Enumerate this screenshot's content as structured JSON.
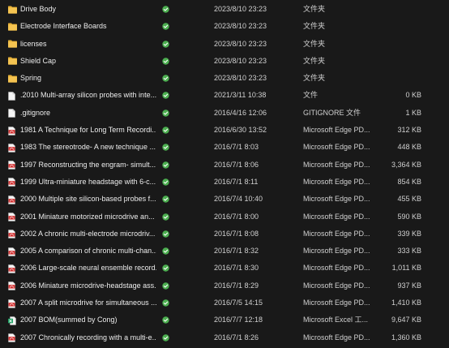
{
  "colors": {
    "background": "#191919",
    "folder": "#e8b339",
    "pdf": "#d32f2f",
    "excel": "#21a366",
    "sync_ok": "#4caf50"
  },
  "files": [
    {
      "icon": "folder-icon",
      "name": "Drive Body",
      "modified": "2023/8/10 23:23",
      "type": "文件夹",
      "size": ""
    },
    {
      "icon": "folder-icon",
      "name": "Electrode Interface Boards",
      "modified": "2023/8/10 23:23",
      "type": "文件夹",
      "size": ""
    },
    {
      "icon": "folder-icon",
      "name": "licenses",
      "modified": "2023/8/10 23:23",
      "type": "文件夹",
      "size": ""
    },
    {
      "icon": "folder-icon",
      "name": "Shield Cap",
      "modified": "2023/8/10 23:23",
      "type": "文件夹",
      "size": ""
    },
    {
      "icon": "folder-icon",
      "name": "Spring",
      "modified": "2023/8/10 23:23",
      "type": "文件夹",
      "size": ""
    },
    {
      "icon": "text-file-icon",
      "name": ".2010 Multi-array silicon probes with inte...",
      "modified": "2021/3/11 10:38",
      "type": "文件",
      "size": "0 KB"
    },
    {
      "icon": "text-file-icon",
      "name": ".gitignore",
      "modified": "2016/4/16 12:06",
      "type": "GITIGNORE 文件",
      "size": "1 KB"
    },
    {
      "icon": "pdf-file-icon",
      "name": "1981 A Technique for Long Term Recordi...",
      "modified": "2016/6/30 13:52",
      "type": "Microsoft Edge PD...",
      "size": "312 KB"
    },
    {
      "icon": "pdf-file-icon",
      "name": "1983 The stereotrode- A new technique ...",
      "modified": "2016/7/1 8:03",
      "type": "Microsoft Edge PD...",
      "size": "448 KB"
    },
    {
      "icon": "pdf-file-icon",
      "name": "1997 Reconstructing the engram- simult...",
      "modified": "2016/7/1 8:06",
      "type": "Microsoft Edge PD...",
      "size": "3,364 KB"
    },
    {
      "icon": "pdf-file-icon",
      "name": "1999 Ultra-miniature headstage with 6-c...",
      "modified": "2016/7/1 8:11",
      "type": "Microsoft Edge PD...",
      "size": "854 KB"
    },
    {
      "icon": "pdf-file-icon",
      "name": "2000 Multiple site silicon-based probes f...",
      "modified": "2016/7/4 10:40",
      "type": "Microsoft Edge PD...",
      "size": "455 KB"
    },
    {
      "icon": "pdf-file-icon",
      "name": "2001 Miniature motorized microdrive an...",
      "modified": "2016/7/1 8:00",
      "type": "Microsoft Edge PD...",
      "size": "590 KB"
    },
    {
      "icon": "pdf-file-icon",
      "name": "2002 A chronic multi-electrode microdriv...",
      "modified": "2016/7/1 8:08",
      "type": "Microsoft Edge PD...",
      "size": "339 KB"
    },
    {
      "icon": "pdf-file-icon",
      "name": "2005 A comparison of chronic multi-chan...",
      "modified": "2016/7/1 8:32",
      "type": "Microsoft Edge PD...",
      "size": "333 KB"
    },
    {
      "icon": "pdf-file-icon",
      "name": "2006 Large-scale neural ensemble record...",
      "modified": "2016/7/1 8:30",
      "type": "Microsoft Edge PD...",
      "size": "1,011 KB"
    },
    {
      "icon": "pdf-file-icon",
      "name": "2006 Miniature microdrive-headstage ass...",
      "modified": "2016/7/1 8:29",
      "type": "Microsoft Edge PD...",
      "size": "937 KB"
    },
    {
      "icon": "pdf-file-icon",
      "name": "2007 A split microdrive for simultaneous ...",
      "modified": "2016/7/5 14:15",
      "type": "Microsoft Edge PD...",
      "size": "1,410 KB"
    },
    {
      "icon": "excel-file-icon",
      "name": "2007 BOM(summed by Cong)",
      "modified": "2016/7/7 12:18",
      "type": "Microsoft Excel 工...",
      "size": "9,647 KB"
    },
    {
      "icon": "pdf-file-icon",
      "name": "2007 Chronically recording with a multi-e...",
      "modified": "2016/7/1 8:26",
      "type": "Microsoft Edge PD...",
      "size": "1,360 KB"
    }
  ]
}
